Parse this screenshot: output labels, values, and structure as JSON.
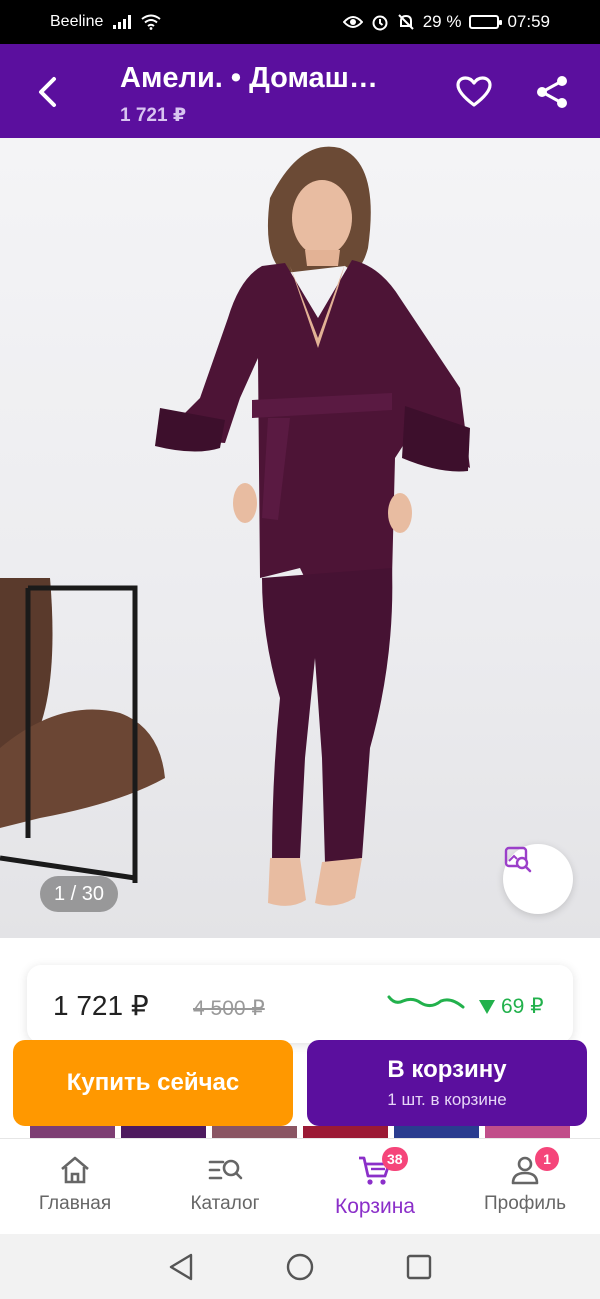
{
  "status_bar": {
    "carrier": "Beeline",
    "battery": "29 %",
    "battery_level": 0.29,
    "time": "07:59"
  },
  "header": {
    "title": "Амели. • Домаш…",
    "price": "1 721 ₽"
  },
  "gallery": {
    "counter": "1 / 30"
  },
  "price_card": {
    "current": "1 721 ₽",
    "old": "4 500 ₽",
    "drop": "69 ₽",
    "trend_color": "#22b14c"
  },
  "actions": {
    "buy_now": "Купить сейчас",
    "to_cart": "В корзину",
    "in_cart": "1 шт. в корзине"
  },
  "bottom_nav": {
    "items": [
      {
        "label": "Главная",
        "icon": "home-icon"
      },
      {
        "label": "Каталог",
        "icon": "catalog-search-icon"
      },
      {
        "label": "Корзина",
        "icon": "cart-icon",
        "badge": "38",
        "active": true
      },
      {
        "label": "Профиль",
        "icon": "profile-icon",
        "badge": "1"
      }
    ]
  },
  "colors": {
    "brand": "#5b0f9e",
    "buy": "#ff9800",
    "badge": "#f5457a",
    "active_nav": "#8b2fc9"
  }
}
